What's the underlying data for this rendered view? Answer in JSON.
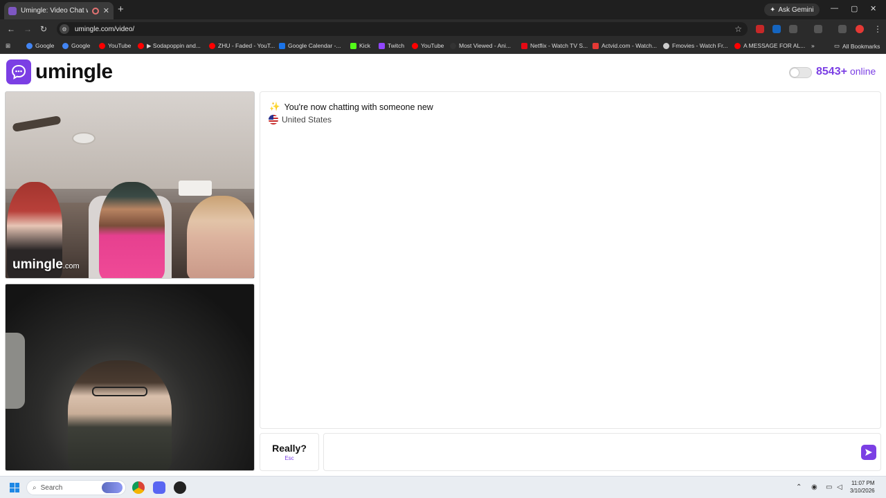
{
  "browser": {
    "tab_title": "Umingle: Video Chat with S",
    "url": "umingle.com/video/",
    "ask_gemini": "Ask Gemini",
    "bookmarks": [
      {
        "label": "Google",
        "color": "#4285f4"
      },
      {
        "label": "Google",
        "color": "#4285f4"
      },
      {
        "label": "YouTube",
        "color": "#ff0000"
      },
      {
        "label": "▶ Sodapoppin and...",
        "color": "#ff0000"
      },
      {
        "label": "ZHU - Faded - YouT...",
        "color": "#ff0000"
      },
      {
        "label": "Google Calendar -...",
        "color": "#1a73e8"
      },
      {
        "label": "Kick",
        "color": "#53fc18"
      },
      {
        "label": "Twitch",
        "color": "#9146ff"
      },
      {
        "label": "YouTube",
        "color": "#ff0000"
      },
      {
        "label": "Most Viewed - Ani...",
        "color": "#333333"
      },
      {
        "label": "Netflix - Watch TV S...",
        "color": "#e50914"
      },
      {
        "label": "Actvid.com - Watch...",
        "color": "#e53935"
      },
      {
        "label": "Fmovies - Watch Fr...",
        "color": "#cccccc"
      },
      {
        "label": "A MESSAGE FOR AL...",
        "color": "#ff0000"
      }
    ],
    "all_bookmarks": "All Bookmarks"
  },
  "header": {
    "logo_text": "umingle",
    "online_count": "8543+",
    "online_label": "online"
  },
  "videos": {
    "watermark_main": "umingle",
    "watermark_suffix": ".com"
  },
  "chat": {
    "system_message": "You're now chatting with someone new",
    "country": "United States"
  },
  "controls": {
    "stop_label": "Really?",
    "stop_hint": "Esc",
    "message_placeholder": ""
  },
  "taskbar": {
    "search_label": "Search",
    "time": "11:07 PM",
    "date": "3/10/2026"
  },
  "colors": {
    "brand": "#7b3fe4"
  }
}
